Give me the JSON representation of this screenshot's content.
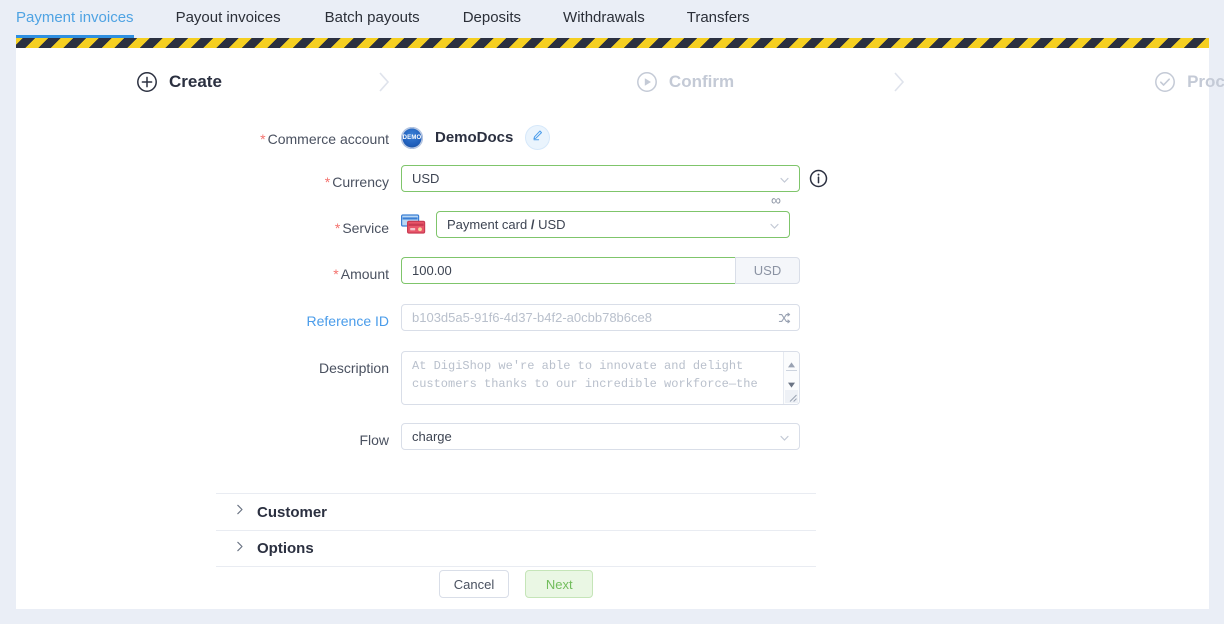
{
  "nav": {
    "tabs": [
      {
        "label": "Payment invoices",
        "active": true
      },
      {
        "label": "Payout invoices",
        "active": false
      },
      {
        "label": "Batch payouts",
        "active": false
      },
      {
        "label": "Deposits",
        "active": false
      },
      {
        "label": "Withdrawals",
        "active": false
      },
      {
        "label": "Transfers",
        "active": false
      }
    ],
    "active_color": "#4fa3e3",
    "underline_color": "#2f8fe0"
  },
  "stripe_bar": {
    "icon": "warning-stripes",
    "colors": [
      "#f5cf21",
      "#2b3040"
    ]
  },
  "stepper": {
    "steps": [
      {
        "label": "Create",
        "icon": "plus-circle-icon",
        "state": "active"
      },
      {
        "label": "Confirm",
        "icon": "play-circle-icon",
        "state": "inactive"
      },
      {
        "label": "Process",
        "icon": "check-circle-icon",
        "state": "inactive"
      }
    ],
    "separator_icon": "chevron-right-icon"
  },
  "form": {
    "commerce_account": {
      "label": "Commerce account",
      "required": true,
      "badge_text": "DEMO",
      "account_name": "DemoDocs",
      "edit_icon": "pencil-icon"
    },
    "currency": {
      "label": "Currency",
      "required": true,
      "value": "USD",
      "border_color": "#7fc56b",
      "info_icon": "info-circle-icon",
      "limit_symbol": "∞"
    },
    "service": {
      "label": "Service",
      "required": true,
      "value_prefix": "Payment card",
      "value_separator": "/",
      "value_suffix": "USD",
      "icon": "payment-card-icon",
      "border_color": "#7fc56b"
    },
    "amount": {
      "label": "Amount",
      "required": true,
      "value": "100.00",
      "currency_addon": "USD",
      "border_color": "#7fc56b"
    },
    "reference_id": {
      "label": "Reference ID",
      "required": false,
      "placeholder": "b103d5a5-91f6-4d37-b4f2-a0cbb78b6ce8",
      "label_color": "#4a9cea",
      "shuffle_icon": "shuffle-icon"
    },
    "description": {
      "label": "Description",
      "required": false,
      "placeholder": "At DigiShop we're able to innovate and delight customers thanks to our incredible workforce—the",
      "scrollbar_up_icon": "caret-up-icon",
      "scrollbar_down_icon": "caret-down-icon",
      "resize_icon": "resize-grip-icon"
    },
    "flow": {
      "label": "Flow",
      "required": false,
      "value": "charge"
    }
  },
  "accordion": [
    {
      "title": "Customer",
      "expanded": false,
      "icon": "chevron-right-icon"
    },
    {
      "title": "Options",
      "expanded": false,
      "icon": "chevron-right-icon"
    }
  ],
  "footer": {
    "cancel_label": "Cancel",
    "next_label": "Next",
    "next_color": "#72bd5c"
  }
}
